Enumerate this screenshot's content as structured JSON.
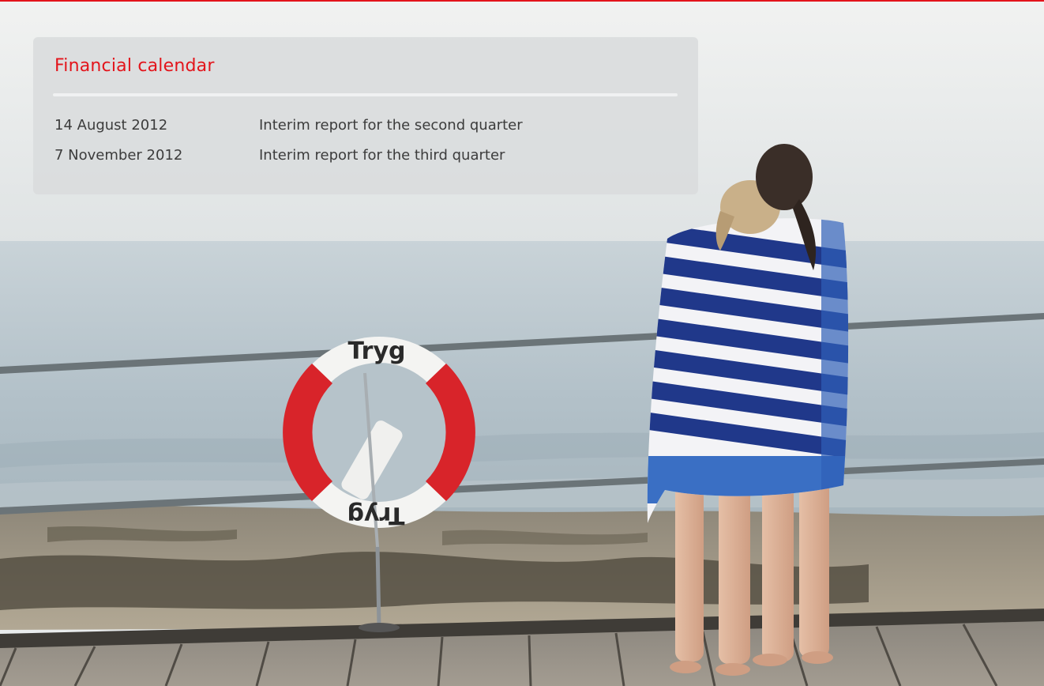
{
  "calendar": {
    "title": "Financial calendar",
    "entries": [
      {
        "date": "14 August 2012",
        "event": "Interim report for the second quarter"
      },
      {
        "date": "7 November 2012",
        "event": "Interim report for the third quarter"
      }
    ]
  },
  "photo": {
    "lifebuoy_text": "Tryg"
  },
  "colors": {
    "accent": "#e3141b",
    "text": "#3c3c3c",
    "towel_blue": "#1f3f94",
    "buoy_red": "#d8242a"
  }
}
